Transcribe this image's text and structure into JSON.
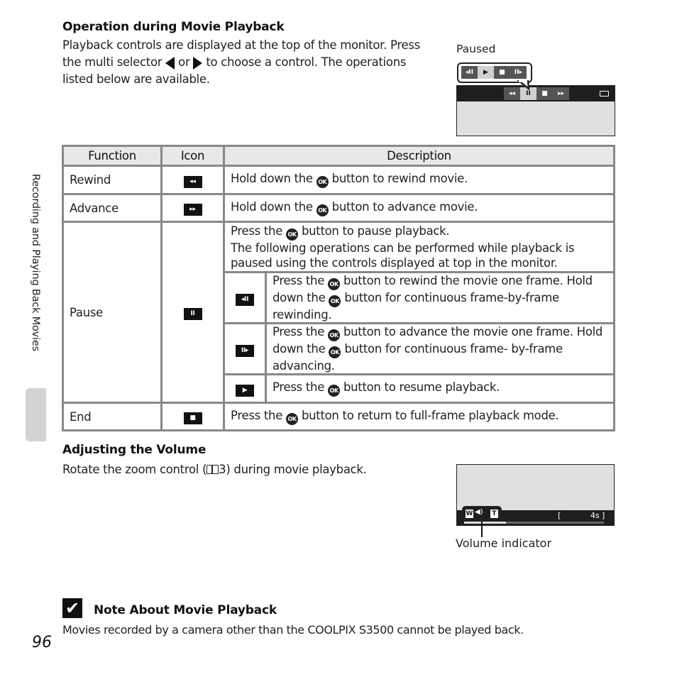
{
  "side_tab": {
    "label": "Recording and Playing Back Movies"
  },
  "section1": {
    "heading": "Operation during Movie Playback",
    "para_line1": "Playback controls are displayed at the top of the monitor. Press",
    "para_line2_pre": "the multi selector",
    "para_line2_or": "or",
    "para_line2_post": "to choose a control. The operations",
    "para_line3": "listed below are available."
  },
  "illustration_paused": {
    "label": "Paused",
    "callout_controls": [
      {
        "icon": "frame-rewind-icon",
        "glyph": "◂II",
        "selected": false
      },
      {
        "icon": "play-icon",
        "glyph": "▶",
        "selected": true
      },
      {
        "icon": "stop-icon",
        "glyph": "■",
        "selected": false
      },
      {
        "icon": "frame-advance-icon",
        "glyph": "II▸",
        "selected": false
      }
    ],
    "monitor_controls": [
      {
        "icon": "rewind-icon",
        "glyph": "◂◂",
        "selected": false
      },
      {
        "icon": "pause-icon",
        "glyph": "II",
        "selected": true
      },
      {
        "icon": "stop-icon",
        "glyph": "■",
        "selected": false
      },
      {
        "icon": "advance-icon",
        "glyph": "▸▸",
        "selected": false
      }
    ]
  },
  "table": {
    "headers": {
      "function": "Function",
      "icon": "Icon",
      "description": "Description"
    },
    "ok_label": "OK",
    "rows": {
      "rewind": {
        "function": "Rewind",
        "glyph": "◂◂",
        "pre": "Hold down the",
        "post": "button to rewind movie."
      },
      "advance": {
        "function": "Advance",
        "glyph": "▸▸",
        "pre": "Hold down the",
        "post": "button to advance movie."
      },
      "pause": {
        "function": "Pause",
        "glyph": "II",
        "pre": "Press the",
        "post": "button to pause playback.",
        "line2": "The following operations can be performed while playback is paused using the controls displayed at top in the monitor.",
        "sub": {
          "frame_rewind": {
            "glyph": "◂II",
            "pre": "Press the",
            "mid": "button to rewind the movie one frame. Hold down the",
            "post": "button for continuous frame-by-frame rewinding."
          },
          "frame_advance": {
            "glyph": "II▸",
            "pre": "Press the",
            "mid": "button to advance the movie one frame. Hold down the",
            "post": "button for continuous frame- by-frame advancing."
          },
          "resume": {
            "glyph": "▶",
            "pre": "Press the",
            "post": "button to resume playback."
          }
        }
      },
      "end": {
        "function": "End",
        "glyph": "■",
        "pre": "Press the",
        "post": "button to return to full-frame playback mode."
      }
    }
  },
  "section2": {
    "heading": "Adjusting the Volume",
    "para_pre": "Rotate the zoom control (",
    "ref_page": "3",
    "para_post": ") during movie playback."
  },
  "illustration_volume": {
    "w_label": "W",
    "t_label": "T",
    "time_open": "[",
    "time_value": "4s",
    "time_close": "]",
    "progress": 0.3,
    "caption": "Volume indicator"
  },
  "note": {
    "heading": "Note About Movie Playback",
    "text": "Movies recorded by a camera other than the COOLPIX S3500 cannot be played back."
  },
  "page_number": "96"
}
